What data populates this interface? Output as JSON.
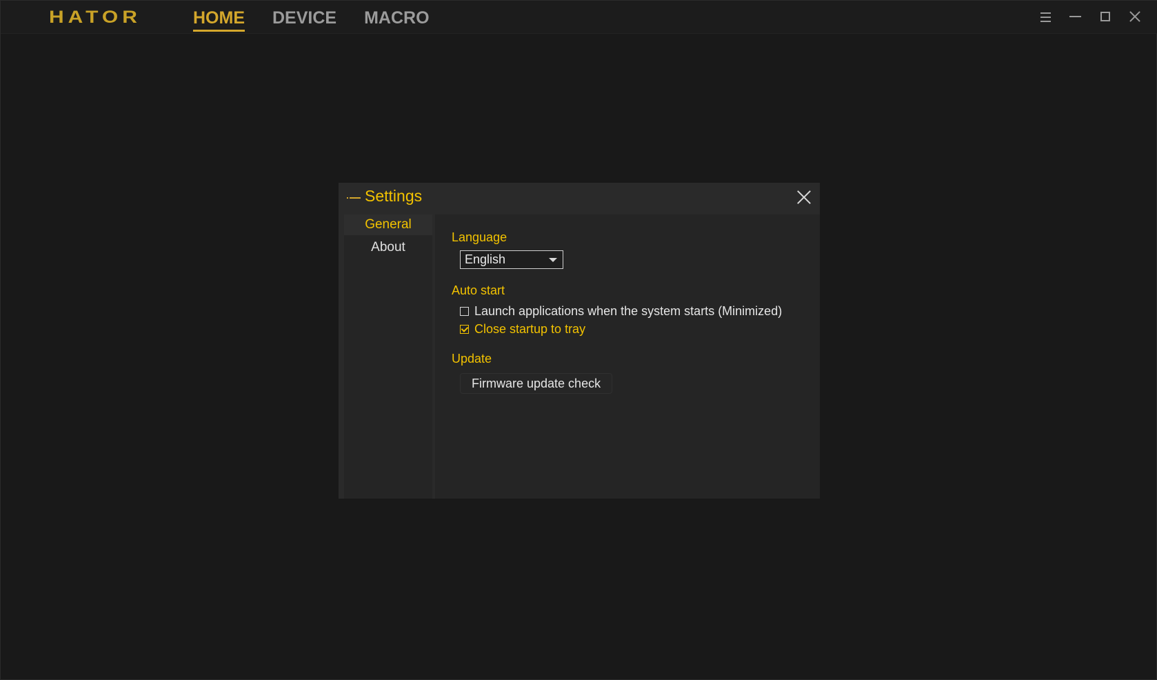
{
  "app": {
    "logo": "HATOR",
    "accent_color": "#d4a72c"
  },
  "nav": {
    "items": [
      {
        "label": "HOME",
        "active": true
      },
      {
        "label": "DEVICE",
        "active": false
      },
      {
        "label": "MACRO",
        "active": false
      }
    ]
  },
  "window_controls": [
    "menu-icon",
    "minimize-icon",
    "maximize-icon",
    "close-icon"
  ],
  "settings": {
    "title": "Settings",
    "tabs": [
      {
        "label": "General",
        "active": true
      },
      {
        "label": "About",
        "active": false
      }
    ],
    "general": {
      "language_label": "Language",
      "language_value": "English",
      "autostart_label": "Auto start",
      "launch_on_startup": {
        "label": "Launch applications when the system starts (Minimized)",
        "checked": false
      },
      "close_to_tray": {
        "label": "Close startup to tray",
        "checked": true
      },
      "update_label": "Update",
      "firmware_button": "Firmware update check"
    }
  }
}
